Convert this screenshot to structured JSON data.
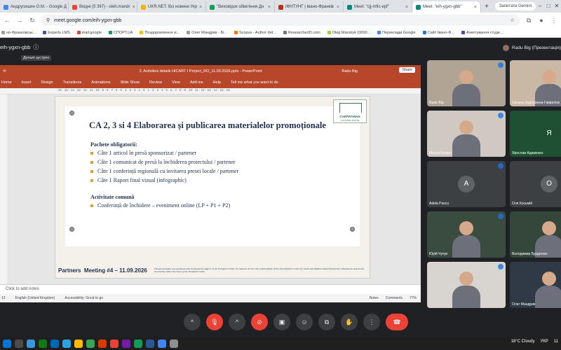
{
  "browser": {
    "tabs": [
      {
        "label": "Андрусишин О.М. - Google Д",
        "color": "#4285f4"
      },
      {
        "label": "Вхідні (5 397) - oleh.mandr",
        "color": "#ea4335"
      },
      {
        "label": "UKR.NET: Всі новини Укр",
        "color": "#f4b400"
      },
      {
        "label": "\"Виховідок обміління Дн",
        "color": "#0f9d58"
      },
      {
        "label": "ІФНТУНГ | Івано-Франків",
        "color": "#b23121"
      },
      {
        "label": "Meet: \"cjj-mfic-epf\"",
        "color": "#00897b"
      },
      {
        "label": "Meet: \"eih-ygxn-gbb\"",
        "color": "#00897b"
      }
    ],
    "new_tab": "+",
    "gemini_label": "Запитати Gemini",
    "url": "meet.google.com/eih-ygxn-gbb",
    "bookmarks": [
      {
        "label": "но-Франковськ...",
        "color": "#9e9e9e"
      },
      {
        "label": "Experts LMS",
        "color": "#3f51b5"
      },
      {
        "label": "mail.google",
        "color": "#ea4335"
      },
      {
        "label": "СПОРТ.UA",
        "color": "#0f9d58"
      },
      {
        "label": "Поздоровлення зі...",
        "color": "#fbbc04"
      },
      {
        "label": "Олег Мандрик - Бі...",
        "color": "#9e9e9e"
      },
      {
        "label": "Scopus - Author det...",
        "color": "#f57c00"
      },
      {
        "label": "ResearcherID.com",
        "color": "#607d8b"
      },
      {
        "label": "Oleg Mandryk (0000...",
        "color": "#a6ce39"
      },
      {
        "label": "Переклади Google",
        "color": "#4285f4"
      },
      {
        "label": "Сайт Івано-Ф...",
        "color": "#1a73e8"
      },
      {
        "label": "Анкетування студе...",
        "color": "#673ab7"
      }
    ]
  },
  "meet": {
    "code": "eih-ygxn-gbb",
    "details_tooltip": "Деталі зустрічі",
    "presenter": "Radu Big (Презентація)"
  },
  "powerpoint": {
    "window_title": "2. Activities details HICART I Project_RO_11.09.2026.pptx - PowerPoint",
    "user": "Radu Big",
    "ribbon_tabs": [
      "Home",
      "Insert",
      "Design",
      "Transitions",
      "Animations",
      "Slide Show",
      "Review",
      "View",
      "Add-ins",
      "Help"
    ],
    "tell_me": "Tell me what you want to do",
    "share_label": "Share",
    "ruler": "· 16 · 15 · 14 · 13 · 12 · 11 · 10 · 9 · 8 · 7 · 6 · 5 · 4 · 3 · 2 · 1 · 0 · 1 · 2 · 3 · 4 · 5 · 6 · 7 · 8 · 9 · 10 · 11 · 12 · 13 · 14 · 15 · 16",
    "notes_placeholder": "Click to add notes",
    "status": {
      "slide": "12",
      "language": "English (United Kingdom)",
      "accessibility": "Accessibility: Good to go",
      "notes_btn": "Notes",
      "comments_btn": "Comments",
      "zoom": "77%"
    }
  },
  "slide": {
    "title": "CA 2, 3 si 4 Elaborarea și publicarea materialelor promoționale",
    "section1_heading": "Pachete obligatorii:",
    "section1_items": [
      "Câte 1 articol în presă sponsorizat / partener",
      "Câte 1 comunicat de presă la închiderea proiectului / partener",
      "Câte 1 conferință regională cu invitarea presei locale / partener",
      "Câte 1 Raport final vizual (infographic)"
    ],
    "section2_heading": "Activitate comună",
    "section2_items": [
      "Conferință de închidere – eveniment online (LP + P1 + P2)"
    ],
    "logo_text": "CARPATHIAN",
    "logo_sub": "CULTURAL ROUTE",
    "footer_partners": "Partners",
    "footer_meeting": "Meeting #4 – 11.09.2026",
    "footer_disclaimer": "This presentation was produced with the financial support of the European Union. Its contents are the sole responsibility of the Development Centre for Small and Medium Sized Enterprises: Maramures and do not necessarily reflect the views of the European Union"
  },
  "participants": [
    {
      "name": "Radu Big",
      "type": "video",
      "bg": "#b0a595"
    },
    {
      "name": "Оксана Задорожна-Гаврилюк",
      "type": "video",
      "bg": "#c9b8a6"
    },
    {
      "name": "Mariya Kovtun",
      "type": "video",
      "bg": "#cfc9c2"
    },
    {
      "name": "Ярослав Адаменко",
      "type": "letter",
      "letter": "Я",
      "bg": "#1e5133",
      "circle": "#1e5133"
    },
    {
      "name": "Adela Pascu",
      "type": "letter",
      "letter": "A",
      "bg": "#3c4043",
      "circle": "#5f6368"
    },
    {
      "name": "Оля Косьмій",
      "type": "letter",
      "letter": "О",
      "bg": "#3c4043",
      "circle": "#5f6368"
    },
    {
      "name": "Юрій Чучук",
      "type": "video",
      "bg": "#3a4b3f"
    },
    {
      "name": "Володимир Бурденюк",
      "type": "video",
      "bg": "#35473a"
    },
    {
      "name": "",
      "type": "video",
      "bg": "#d8d4d0"
    },
    {
      "name": "Олег Мандрик",
      "type": "video",
      "bg": "#2f3a46"
    }
  ],
  "controls": [
    {
      "name": "mic-options",
      "icon": "^"
    },
    {
      "name": "mic-toggle",
      "icon": "🎙"
    },
    {
      "name": "cam-options",
      "icon": "^"
    },
    {
      "name": "cam-toggle",
      "icon": "⊘"
    },
    {
      "name": "captions",
      "icon": "▣"
    },
    {
      "name": "emoji",
      "icon": "☺"
    },
    {
      "name": "present",
      "icon": "⧉"
    },
    {
      "name": "raise-hand",
      "icon": "✋"
    },
    {
      "name": "more",
      "icon": "⋮"
    },
    {
      "name": "leave",
      "icon": "☎"
    }
  ],
  "tray": {
    "weather": "18°C  Cloudy",
    "lang": "УКР",
    "time": "11"
  }
}
